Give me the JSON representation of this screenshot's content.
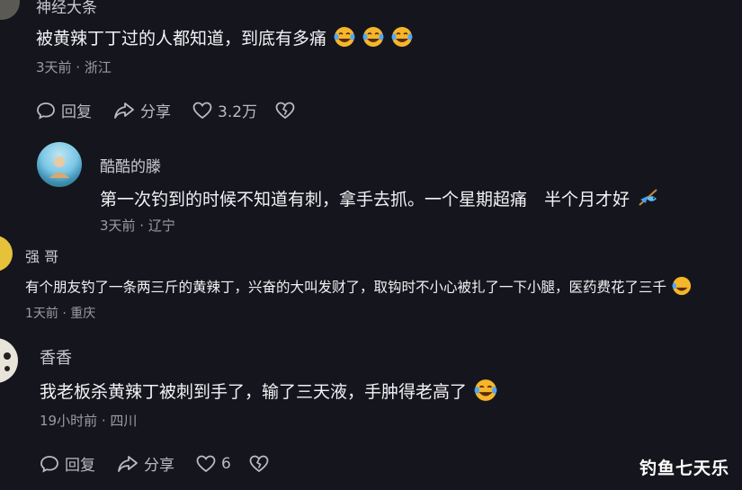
{
  "comments": [
    {
      "name": "神经大条",
      "text": "被黄辣丁丁过的人都知道，到底有多痛",
      "meta": "3天前 · 浙江",
      "reply_label": "回复",
      "share_label": "分享",
      "likes": "3.2万"
    },
    {
      "name": "酷酷的滕",
      "text": "第一次钓到的时候不知道有刺，拿手去抓。一个星期超痛　半个月才好",
      "meta": "3天前 · 辽宁"
    },
    {
      "name": "强 哥",
      "text": "有个朋友钓了一条两三斤的黄辣丁，兴奋的大叫发财了，取钩时不小心被扎了一下小腿，医药费花了三千",
      "meta": "1天前 · 重庆"
    },
    {
      "name": "香香",
      "text": "我老板杀黄辣丁被刺到手了，输了三天液，手肿得老高了",
      "meta": "19小时前 · 四川",
      "reply_label": "回复",
      "share_label": "分享",
      "likes": "6"
    }
  ],
  "watermark": "钓鱼七天乐",
  "colors": {
    "background": "#15151d",
    "text": "#f2f2f5",
    "meta": "#9a9ba6"
  }
}
